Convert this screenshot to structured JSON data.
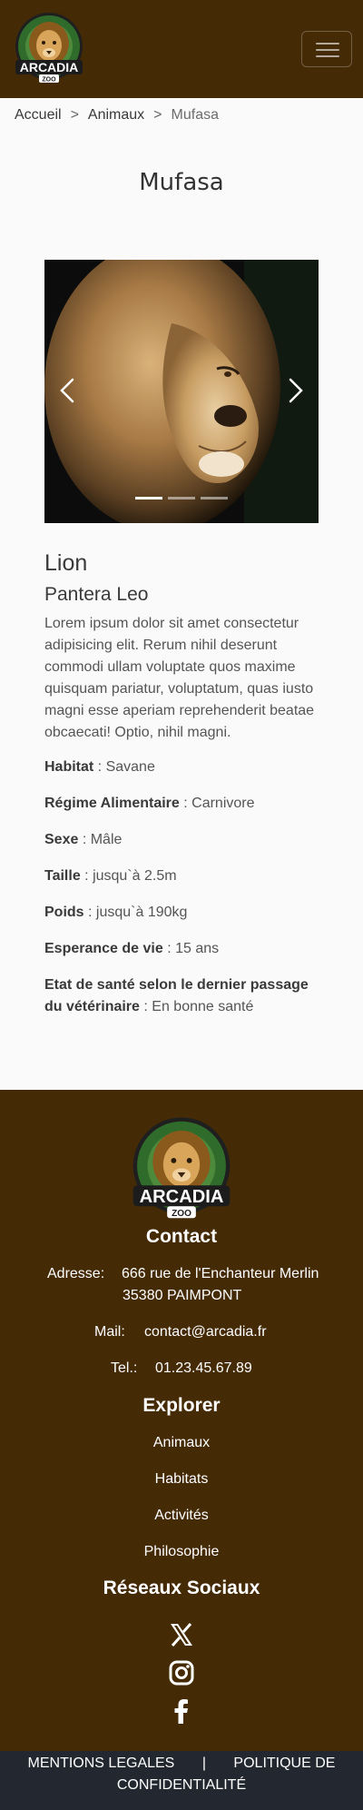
{
  "header": {
    "logo_text": "ARCADIA",
    "logo_sub": "ZOO",
    "menu_icon": "hamburger-menu-icon"
  },
  "breadcrumb": {
    "home": "Accueil",
    "animals": "Animaux",
    "current": "Mufasa",
    "sep": ">"
  },
  "page": {
    "title": "Mufasa"
  },
  "carousel": {
    "slides": 3,
    "active": 0,
    "prev_icon": "chevron-left-icon",
    "next_icon": "chevron-right-icon"
  },
  "animal": {
    "race": "Lion",
    "species": "Pantera Leo",
    "description": "Lorem ipsum dolor sit amet consectetur adipisicing elit. Rerum nihil deserunt commodi ullam voluptate quos maxime quisquam pariatur, voluptatum, quas iusto magni esse aperiam reprehenderit beatae obcaecati! Optio, nihil magni.",
    "habitat_label": "Habitat",
    "habitat": "Savane",
    "diet_label": "Régime Alimentaire",
    "diet": "Carnivore",
    "sex_label": "Sexe",
    "sex": "Mâle",
    "size_label": "Taille",
    "size": "jusqu`à 2.5m",
    "weight_label": "Poids",
    "weight": "jusqu`à 190kg",
    "life_label": "Esperance de vie",
    "life": "15 ans",
    "health_label": "Etat de santé selon le dernier passage du vétérinaire",
    "health": "En bonne santé",
    "sep": " : "
  },
  "footer": {
    "contact_title": "Contact",
    "address_label": "Adresse:",
    "address_line1": "666 rue de l'Enchanteur Merlin",
    "address_line2": "35380 PAIMPONT",
    "mail_label": "Mail:",
    "mail": "contact@arcadia.fr",
    "tel_label": "Tel.:",
    "tel": "01.23.45.67.89",
    "explore_title": "Explorer",
    "links": [
      "Animaux",
      "Habitats",
      "Activités",
      "Philosophie"
    ],
    "social_title": "Réseaux Sociaux",
    "social_icons": [
      "x-twitter-icon",
      "instagram-icon",
      "facebook-icon"
    ]
  },
  "bottom": {
    "legal": "MENTIONS LEGALES",
    "sep": "|",
    "privacy": "POLITIQUE DE CONFIDENTIALITÉ"
  },
  "colors": {
    "brown": "#452a06",
    "dark": "#232830",
    "bg": "#fafafa"
  }
}
